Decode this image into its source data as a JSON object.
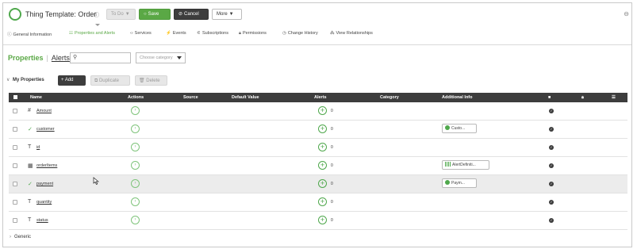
{
  "header": {
    "title": "Thing Template: Order",
    "help_icon": "help-circle-icon",
    "todo_label": "To Do",
    "save_label": "Save",
    "cancel_label": "Cancel",
    "more_label": "More"
  },
  "tabs": [
    {
      "label": "General Information",
      "icon": "info-icon",
      "active": false
    },
    {
      "label": "Properties and Alerts",
      "icon": "properties-icon",
      "active": true
    },
    {
      "label": "Services",
      "icon": "code-icon",
      "active": false
    },
    {
      "label": "Events",
      "icon": "bolt-icon",
      "active": false
    },
    {
      "label": "Subscriptions",
      "icon": "subscription-icon",
      "active": false
    },
    {
      "label": "Permissions",
      "icon": "lock-icon",
      "active": false
    },
    {
      "label": "Change History",
      "icon": "clock-icon",
      "active": false
    },
    {
      "label": "View Relationships",
      "icon": "relationships-icon",
      "active": false
    }
  ],
  "subnav": {
    "properties": "Properties",
    "separator": "|",
    "alerts": "Alerts",
    "search_placeholder": "",
    "category_placeholder": "Choose category"
  },
  "toolbar": {
    "section_label": "My Properties",
    "add_label": "+ Add",
    "duplicate_label": "Duplicate",
    "delete_label": "Delete"
  },
  "table": {
    "columns": [
      "Name",
      "Actions",
      "Source",
      "Default Value",
      "Alerts",
      "Category",
      "Additional Info"
    ],
    "rows": [
      {
        "type_glyph": "#",
        "type_icon": "number-icon",
        "name": "Amount",
        "alerts": "0",
        "info": "",
        "info_icon": "",
        "highlight": false
      },
      {
        "type_glyph": "✓",
        "type_icon": "boolean-icon",
        "name": "customer",
        "alerts": "0",
        "info": "Custo...",
        "info_icon": "thing-dot-icon",
        "highlight": false
      },
      {
        "type_glyph": "T",
        "type_icon": "string-icon",
        "name": "id",
        "alerts": "0",
        "info": "",
        "info_icon": "",
        "highlight": false
      },
      {
        "type_glyph": "▦",
        "type_icon": "infotable-icon",
        "name": "orderItems",
        "alerts": "0",
        "info": "AlertDefiniti...",
        "info_icon": "datashape-icon",
        "highlight": false
      },
      {
        "type_glyph": "✓",
        "type_icon": "boolean-icon",
        "name": "payment",
        "alerts": "0",
        "info": "Paym...",
        "info_icon": "thing-dot-icon",
        "highlight": true
      },
      {
        "type_glyph": "T",
        "type_icon": "string-icon",
        "name": "quantity",
        "alerts": "0",
        "info": "",
        "info_icon": "",
        "highlight": false
      },
      {
        "type_glyph": "T",
        "type_icon": "string-icon",
        "name": "status",
        "alerts": "0",
        "info": "",
        "info_icon": "",
        "highlight": false
      }
    ]
  },
  "footer": {
    "generic_label": "Generic"
  },
  "colors": {
    "accent": "#5aa845",
    "dark": "#3d3d3d"
  }
}
